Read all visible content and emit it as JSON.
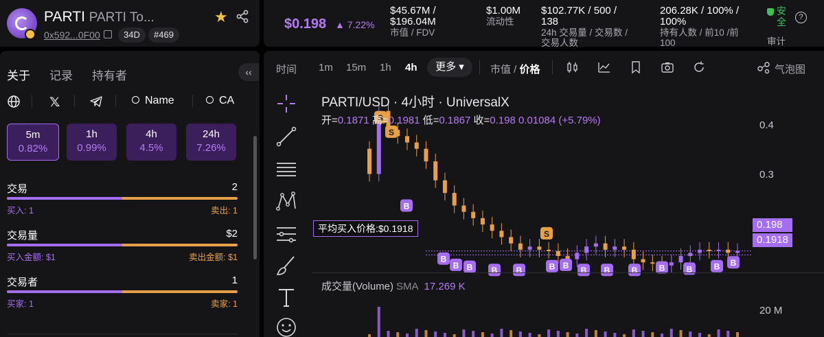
{
  "token": {
    "symbol": "PARTI",
    "name": "PARTI To...",
    "address": "0x592...0F00",
    "age": "34D",
    "rank": "#469"
  },
  "stats": {
    "price": "$0.198",
    "change": "▲ 7.22%",
    "mcap_value": "$45.67M /",
    "mcap_value2": "$196.04M",
    "mcap_label": "市值 / FDV",
    "liquidity_value": "$1.00M",
    "liquidity_label": "流动性",
    "volume_value": "$102.77K / 500 /",
    "volume_value2": "138",
    "volume_label": "24h 交易量 / 交易数 /",
    "volume_label2": "交易人数",
    "holders_value": "206.28K / 100% /",
    "holders_value2": "100%",
    "holders_label": "持有人数 / 前10 /前",
    "holders_label2": "100",
    "safe_text": "安全",
    "audit_label": "审计"
  },
  "left_panel": {
    "tabs": [
      "关于",
      "记录",
      "持有者"
    ],
    "socials": {
      "name_link": "Name",
      "ca_link": "CA"
    },
    "timeframes": [
      {
        "label": "5m",
        "value": "0.82%",
        "active": true
      },
      {
        "label": "1h",
        "value": "0.99%",
        "active": false
      },
      {
        "label": "4h",
        "value": "4.5%",
        "active": false
      },
      {
        "label": "24h",
        "value": "7.26%",
        "active": false
      }
    ],
    "metrics": [
      {
        "title": "交易",
        "value": "2",
        "buy_label": "买入: 1",
        "sell_label": "卖出: 1",
        "buy_fraction": 0.5
      },
      {
        "title": "交易量",
        "value": "$2",
        "buy_label": "买入金额: $1",
        "sell_label": "卖出金额: $1",
        "buy_fraction": 0.5
      },
      {
        "title": "交易者",
        "value": "1",
        "buy_label": "买家: 1",
        "sell_label": "卖家: 1",
        "buy_fraction": 0.5
      }
    ]
  },
  "chart_toolbar": {
    "time_label": "时间",
    "intervals": [
      "1m",
      "15m",
      "1h",
      "4h"
    ],
    "active_interval": "4h",
    "more_label": "更多 ▾",
    "mcap_label": "市值",
    "price_label": "价格",
    "bubble_label": "气泡图"
  },
  "chart": {
    "title": "PARTI/USD · 4小时 · UniversalX",
    "open_label": "开=",
    "open": "0.1871",
    "high_label": "高=",
    "high": "0.1981",
    "low_label": "低=",
    "low": "0.1867",
    "close_label": "收=",
    "close": "0.198",
    "change": "0.01084 (+5.79%)",
    "avg_buy_label": "平均买入价格:$0.1918",
    "current_price_tag": "0.198",
    "avg_price_tag": "0.1918",
    "y_ticks": [
      "0.4",
      "0.3"
    ],
    "volume_title": "成交量(Volume)",
    "volume_sma": "SMA",
    "volume_value": "17.269 K",
    "volume_tick": "20 M"
  },
  "chart_data": {
    "type": "candlestick",
    "interval": "4h",
    "pair": "PARTI/USD",
    "y_ticks": [
      0.4,
      0.3
    ],
    "approx_close_series": [
      0.32,
      0.42,
      0.39,
      0.38,
      0.37,
      0.36,
      0.34,
      0.31,
      0.29,
      0.27,
      0.26,
      0.25,
      0.24,
      0.23,
      0.22,
      0.21,
      0.2,
      0.205,
      0.2,
      0.198,
      0.19,
      0.185,
      0.195,
      0.205,
      0.21,
      0.2,
      0.205,
      0.2,
      0.185,
      0.18,
      0.178,
      0.175,
      0.18,
      0.19,
      0.195,
      0.2,
      0.198,
      0.2,
      0.195,
      0.198
    ],
    "current_price": 0.198,
    "avg_buy_price": 0.1918,
    "buy_marker_label": "B",
    "sell_marker_label": "S"
  },
  "colors": {
    "accent": "#a56ef2",
    "orange": "#e8a048",
    "safe": "#3ec25a",
    "panel": "#151517"
  }
}
